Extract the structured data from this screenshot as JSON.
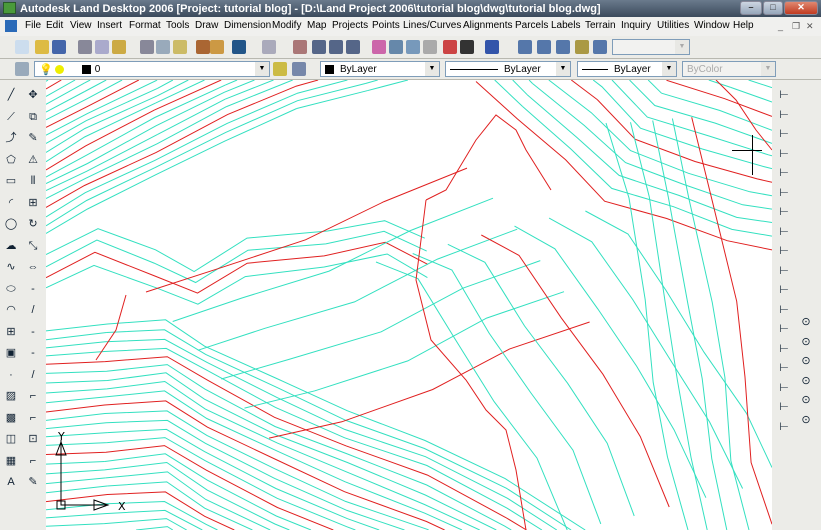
{
  "window": {
    "title": "Autodesk Land Desktop 2006 [Project: tutorial blog] - [D:\\Land Project 2006\\tutorial blog\\dwg\\tutorial blog.dwg]"
  },
  "menu": [
    "File",
    "Edit",
    "View",
    "Insert",
    "Format",
    "Tools",
    "Draw",
    "Dimension",
    "Modify",
    "Map",
    "Projects",
    "Points",
    "Lines/Curves",
    "Alignments",
    "Parcels",
    "Labels",
    "Terrain",
    "Inquiry",
    "Utilities",
    "Window",
    "Help"
  ],
  "layers": {
    "current_layer": "0",
    "color": "ByLayer",
    "linetype": "ByLayer",
    "lineweight": "ByLayer",
    "plotstyle": "ByColor"
  },
  "ucs": {
    "x_label": "X",
    "y_label": "Y"
  },
  "colors": {
    "contour_minor": "#33e0c0",
    "contour_major": "#e02020",
    "background": "#ffffff"
  }
}
